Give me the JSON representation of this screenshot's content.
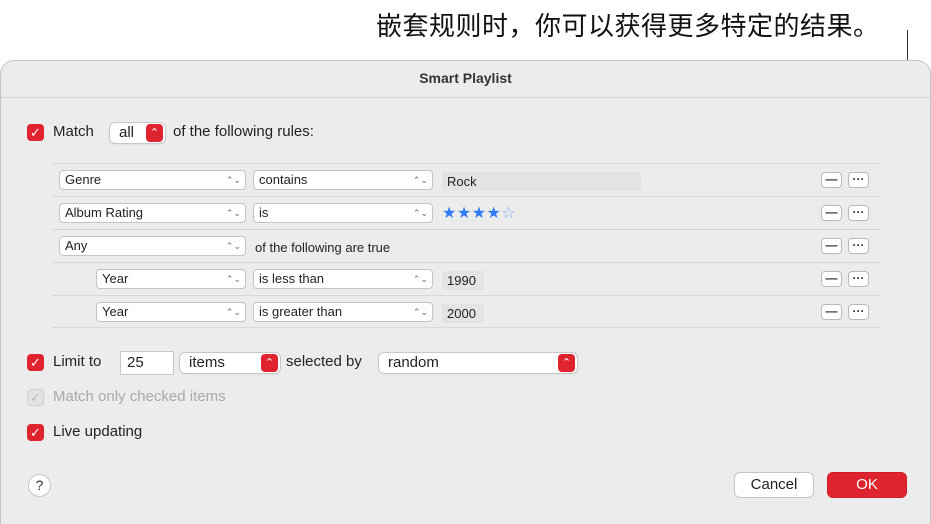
{
  "callout": {
    "text": "嵌套规则时，你可以获得更多特定的结果。"
  },
  "dialog": {
    "title": "Smart Playlist"
  },
  "match": {
    "checked_glyph": "✓",
    "label": "Match",
    "mode": "all",
    "suffix": "of the following rules:"
  },
  "rules": [
    {
      "field": "Genre",
      "operator": "contains",
      "value": "Rock"
    },
    {
      "field": "Album Rating",
      "operator": "is",
      "stars_filled": "★★★★",
      "stars_empty": "☆",
      "rating": 4
    },
    {
      "field": "Any",
      "text": "of the following are true"
    },
    {
      "field": "Year",
      "operator": "is less than",
      "value": "1990"
    },
    {
      "field": "Year",
      "operator": "is greater than",
      "value": "2000"
    }
  ],
  "rule_buttons": {
    "remove": "—",
    "more": "···"
  },
  "limit": {
    "label": "Limit to",
    "value": "25",
    "unit": "items",
    "selected_by_label": "selected by",
    "selected_by": "random"
  },
  "match_checked": {
    "label": "Match only checked items"
  },
  "live_updating": {
    "label": "Live updating"
  },
  "footer": {
    "help": "?",
    "cancel": "Cancel",
    "ok": "OK"
  },
  "colors": {
    "accent": "#e0242f",
    "star": "#2f7cf6"
  },
  "icons": {
    "checkbox": "checkmark-icon",
    "stepper": "up-down-chevron-icon",
    "help": "question-mark-icon"
  }
}
